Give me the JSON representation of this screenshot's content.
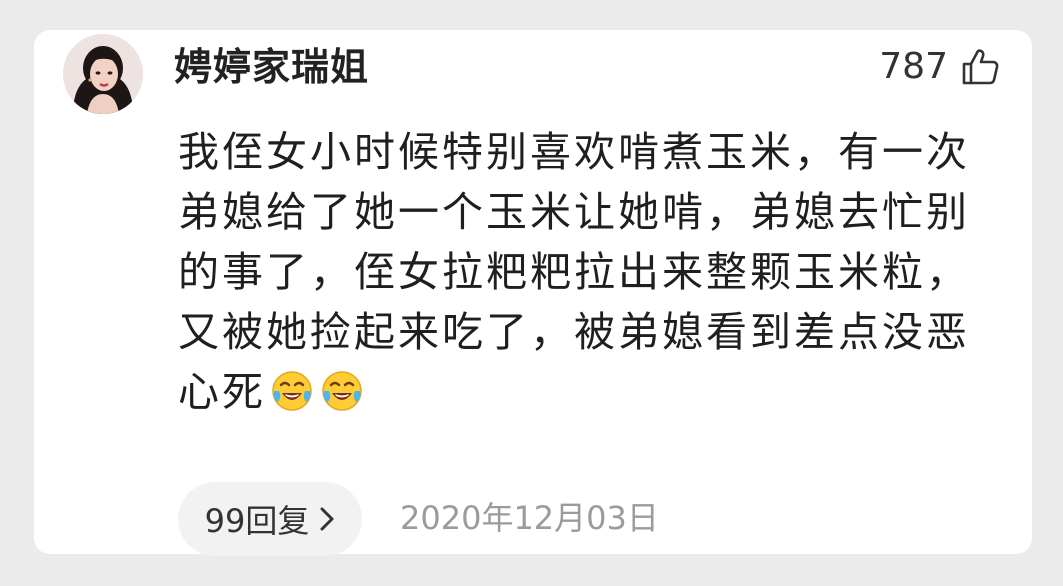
{
  "comment": {
    "username": "娉婷家瑞姐",
    "like_count": "787",
    "like_icon": "thumbs-up-outline-icon",
    "text_lines": [
      "我侄女小时候特别喜欢啃煮玉米，有一次",
      "弟媳给了她一个玉米让她啃，弟媳去忙别",
      "的事了，侄女拉粑粑拉出来整颗玉米粒，",
      "又被她捡起来吃了，被弟媳看到差点没恶",
      "心死"
    ],
    "trailing_emojis": [
      "laughing-crying-emoji",
      "laughing-crying-emoji"
    ],
    "reply_label": "99回复",
    "reply_icon": "chevron-right-icon",
    "date": "2020年12月03日"
  },
  "colors": {
    "background": "#ebebeb",
    "card": "#ffffff",
    "text": "#1f1f1f",
    "muted": "#9b9b9b",
    "pill": "#f2f2f2"
  }
}
